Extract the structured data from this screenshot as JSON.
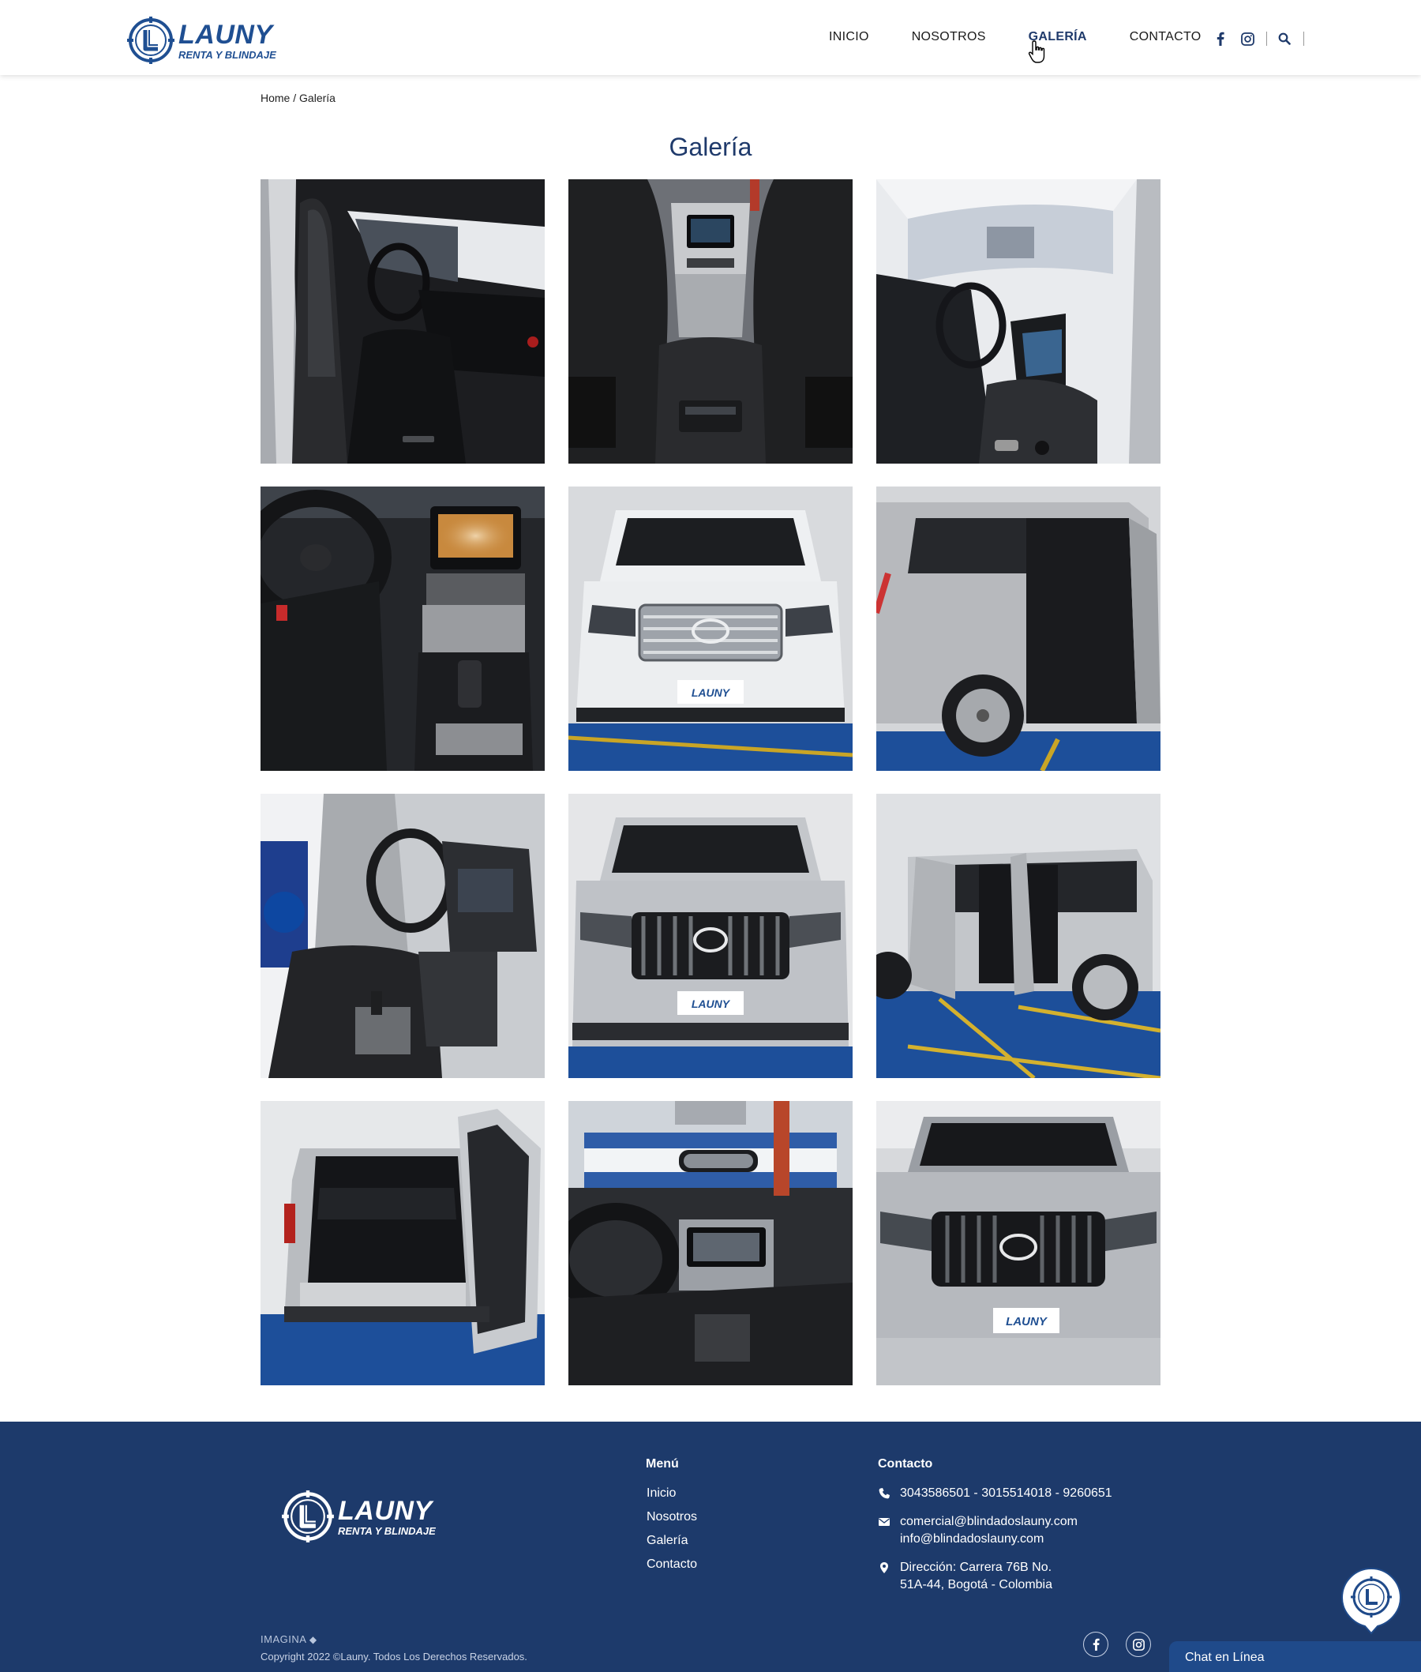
{
  "brand": {
    "name": "LAUNY",
    "tagline": "RENTA Y BLINDAJE"
  },
  "nav": {
    "items": [
      {
        "label": "INICIO",
        "active": false
      },
      {
        "label": "NOSOTROS",
        "active": false
      },
      {
        "label": "GALERÍA",
        "active": true
      },
      {
        "label": "CONTACTO",
        "active": false
      }
    ],
    "icons": [
      "facebook-icon",
      "instagram-icon",
      "search-icon"
    ]
  },
  "breadcrumb": {
    "home": "Home",
    "separator": " / ",
    "current": "Galería"
  },
  "page": {
    "title": "Galería"
  },
  "gallery": {
    "photos": [
      {
        "subject": "interior-driver-side",
        "tone": "dark"
      },
      {
        "subject": "rear-seat-console",
        "tone": "dark"
      },
      {
        "subject": "interior-passenger-side",
        "tone": "light"
      },
      {
        "subject": "dashboard-steering",
        "tone": "dark"
      },
      {
        "subject": "front-land-cruiser",
        "tone": "light"
      },
      {
        "subject": "side-open-door",
        "tone": "silver"
      },
      {
        "subject": "interior-door-open",
        "tone": "dark"
      },
      {
        "subject": "front-prado",
        "tone": "silver"
      },
      {
        "subject": "side-doors-open",
        "tone": "light"
      },
      {
        "subject": "rear-trunk-open",
        "tone": "light"
      },
      {
        "subject": "dashboard-mirror",
        "tone": "dark"
      },
      {
        "subject": "front-prado-2",
        "tone": "silver"
      }
    ],
    "plate_text": "LAUNY"
  },
  "footer": {
    "menu_title": "Menú",
    "menu": [
      "Inicio",
      "Nosotros",
      "Galería",
      "Contacto"
    ],
    "contact_title": "Contacto",
    "phones": "3043586501 - 3015514018 -  9260651",
    "email_1": "comercial@blindadoslauny.com",
    "email_2": "info@blindadoslauny.com",
    "address_1": "Dirección: Carrera 76B No.",
    "address_2": "51A-44, Bogotá - Colombia",
    "developer": "IMAGINA",
    "copyright": "Copyright 2022 ©Launy. Todos Los Derechos Reservados.",
    "social_icons": [
      "facebook-icon",
      "instagram-icon"
    ]
  },
  "chat": {
    "label": "Chat en Línea"
  },
  "colors": {
    "primary": "#1f3a6b",
    "footer_bg": "#1d3a6b",
    "chat_bar": "#1f4a8a",
    "brand_blue": "#1f4f92"
  }
}
